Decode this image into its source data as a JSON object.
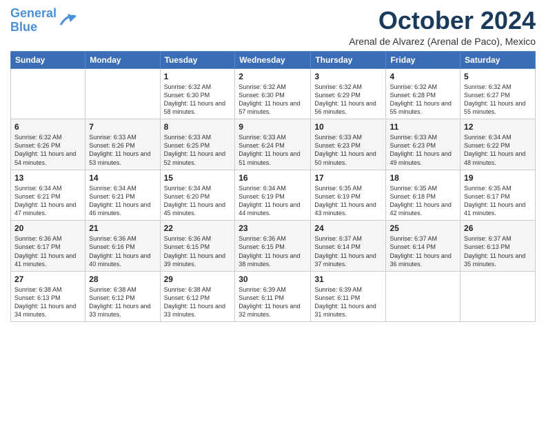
{
  "logo": {
    "line1": "General",
    "line2": "Blue"
  },
  "title": "October 2024",
  "location": "Arenal de Alvarez (Arenal de Paco), Mexico",
  "days_of_week": [
    "Sunday",
    "Monday",
    "Tuesday",
    "Wednesday",
    "Thursday",
    "Friday",
    "Saturday"
  ],
  "weeks": [
    [
      {
        "num": "",
        "info": ""
      },
      {
        "num": "",
        "info": ""
      },
      {
        "num": "1",
        "info": "Sunrise: 6:32 AM\nSunset: 6:30 PM\nDaylight: 11 hours and 58 minutes."
      },
      {
        "num": "2",
        "info": "Sunrise: 6:32 AM\nSunset: 6:30 PM\nDaylight: 11 hours and 57 minutes."
      },
      {
        "num": "3",
        "info": "Sunrise: 6:32 AM\nSunset: 6:29 PM\nDaylight: 11 hours and 56 minutes."
      },
      {
        "num": "4",
        "info": "Sunrise: 6:32 AM\nSunset: 6:28 PM\nDaylight: 11 hours and 55 minutes."
      },
      {
        "num": "5",
        "info": "Sunrise: 6:32 AM\nSunset: 6:27 PM\nDaylight: 11 hours and 55 minutes."
      }
    ],
    [
      {
        "num": "6",
        "info": "Sunrise: 6:32 AM\nSunset: 6:26 PM\nDaylight: 11 hours and 54 minutes."
      },
      {
        "num": "7",
        "info": "Sunrise: 6:33 AM\nSunset: 6:26 PM\nDaylight: 11 hours and 53 minutes."
      },
      {
        "num": "8",
        "info": "Sunrise: 6:33 AM\nSunset: 6:25 PM\nDaylight: 11 hours and 52 minutes."
      },
      {
        "num": "9",
        "info": "Sunrise: 6:33 AM\nSunset: 6:24 PM\nDaylight: 11 hours and 51 minutes."
      },
      {
        "num": "10",
        "info": "Sunrise: 6:33 AM\nSunset: 6:23 PM\nDaylight: 11 hours and 50 minutes."
      },
      {
        "num": "11",
        "info": "Sunrise: 6:33 AM\nSunset: 6:23 PM\nDaylight: 11 hours and 49 minutes."
      },
      {
        "num": "12",
        "info": "Sunrise: 6:34 AM\nSunset: 6:22 PM\nDaylight: 11 hours and 48 minutes."
      }
    ],
    [
      {
        "num": "13",
        "info": "Sunrise: 6:34 AM\nSunset: 6:21 PM\nDaylight: 11 hours and 47 minutes."
      },
      {
        "num": "14",
        "info": "Sunrise: 6:34 AM\nSunset: 6:21 PM\nDaylight: 11 hours and 46 minutes."
      },
      {
        "num": "15",
        "info": "Sunrise: 6:34 AM\nSunset: 6:20 PM\nDaylight: 11 hours and 45 minutes."
      },
      {
        "num": "16",
        "info": "Sunrise: 6:34 AM\nSunset: 6:19 PM\nDaylight: 11 hours and 44 minutes."
      },
      {
        "num": "17",
        "info": "Sunrise: 6:35 AM\nSunset: 6:19 PM\nDaylight: 11 hours and 43 minutes."
      },
      {
        "num": "18",
        "info": "Sunrise: 6:35 AM\nSunset: 6:18 PM\nDaylight: 11 hours and 42 minutes."
      },
      {
        "num": "19",
        "info": "Sunrise: 6:35 AM\nSunset: 6:17 PM\nDaylight: 11 hours and 41 minutes."
      }
    ],
    [
      {
        "num": "20",
        "info": "Sunrise: 6:36 AM\nSunset: 6:17 PM\nDaylight: 11 hours and 41 minutes."
      },
      {
        "num": "21",
        "info": "Sunrise: 6:36 AM\nSunset: 6:16 PM\nDaylight: 11 hours and 40 minutes."
      },
      {
        "num": "22",
        "info": "Sunrise: 6:36 AM\nSunset: 6:15 PM\nDaylight: 11 hours and 39 minutes."
      },
      {
        "num": "23",
        "info": "Sunrise: 6:36 AM\nSunset: 6:15 PM\nDaylight: 11 hours and 38 minutes."
      },
      {
        "num": "24",
        "info": "Sunrise: 6:37 AM\nSunset: 6:14 PM\nDaylight: 11 hours and 37 minutes."
      },
      {
        "num": "25",
        "info": "Sunrise: 6:37 AM\nSunset: 6:14 PM\nDaylight: 11 hours and 36 minutes."
      },
      {
        "num": "26",
        "info": "Sunrise: 6:37 AM\nSunset: 6:13 PM\nDaylight: 11 hours and 35 minutes."
      }
    ],
    [
      {
        "num": "27",
        "info": "Sunrise: 6:38 AM\nSunset: 6:13 PM\nDaylight: 11 hours and 34 minutes."
      },
      {
        "num": "28",
        "info": "Sunrise: 6:38 AM\nSunset: 6:12 PM\nDaylight: 11 hours and 33 minutes."
      },
      {
        "num": "29",
        "info": "Sunrise: 6:38 AM\nSunset: 6:12 PM\nDaylight: 11 hours and 33 minutes."
      },
      {
        "num": "30",
        "info": "Sunrise: 6:39 AM\nSunset: 6:11 PM\nDaylight: 11 hours and 32 minutes."
      },
      {
        "num": "31",
        "info": "Sunrise: 6:39 AM\nSunset: 6:11 PM\nDaylight: 11 hours and 31 minutes."
      },
      {
        "num": "",
        "info": ""
      },
      {
        "num": "",
        "info": ""
      }
    ]
  ]
}
